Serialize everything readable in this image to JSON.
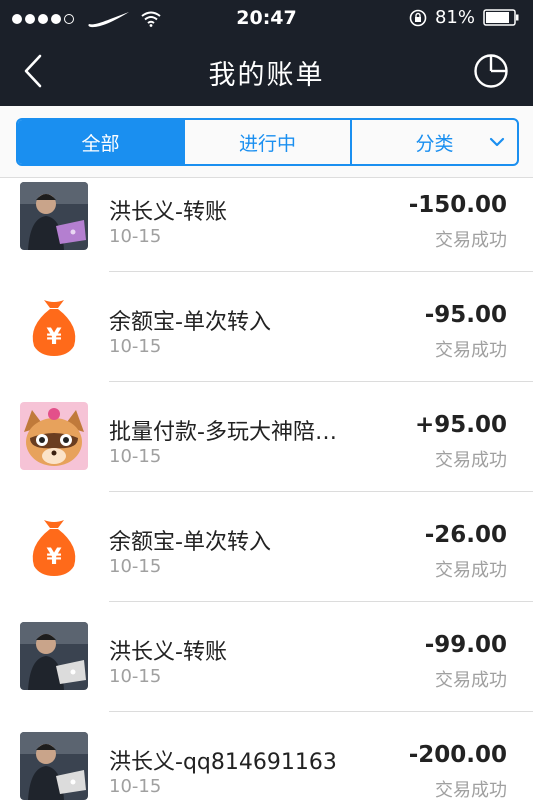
{
  "status_bar": {
    "time": "20:47",
    "battery": "81%"
  },
  "nav": {
    "title": "我的账单",
    "back_icon": "chevron-left-icon",
    "chart_icon": "pie-chart-icon"
  },
  "tabs": [
    {
      "label": "全部",
      "active": true
    },
    {
      "label": "进行中",
      "active": false
    },
    {
      "label": "分类",
      "active": false
    }
  ],
  "colors": {
    "accent": "#1a8ff0",
    "header_bg": "#1b2029",
    "yuebao_orange": "#ff6a1a"
  },
  "transactions": [
    {
      "name": "洪长义-转账",
      "date": "10-15",
      "amount": "-150.00",
      "status": "交易成功",
      "icon": "person-photo"
    },
    {
      "name": "余额宝-单次转入",
      "date": "10-15",
      "amount": "-95.00",
      "status": "交易成功",
      "icon": "yuebao-bag-icon"
    },
    {
      "name": "批量付款-多玩大神陪…",
      "date": "10-15",
      "amount": "+95.00",
      "status": "交易成功",
      "icon": "raccoon-avatar"
    },
    {
      "name": "余额宝-单次转入",
      "date": "10-15",
      "amount": "-26.00",
      "status": "交易成功",
      "icon": "yuebao-bag-icon"
    },
    {
      "name": "洪长义-转账",
      "date": "10-15",
      "amount": "-99.00",
      "status": "交易成功",
      "icon": "person-photo"
    },
    {
      "name": "洪长义-qq814691163",
      "date": "10-15",
      "amount": "-200.00",
      "status": "交易成功",
      "icon": "person-photo"
    }
  ]
}
